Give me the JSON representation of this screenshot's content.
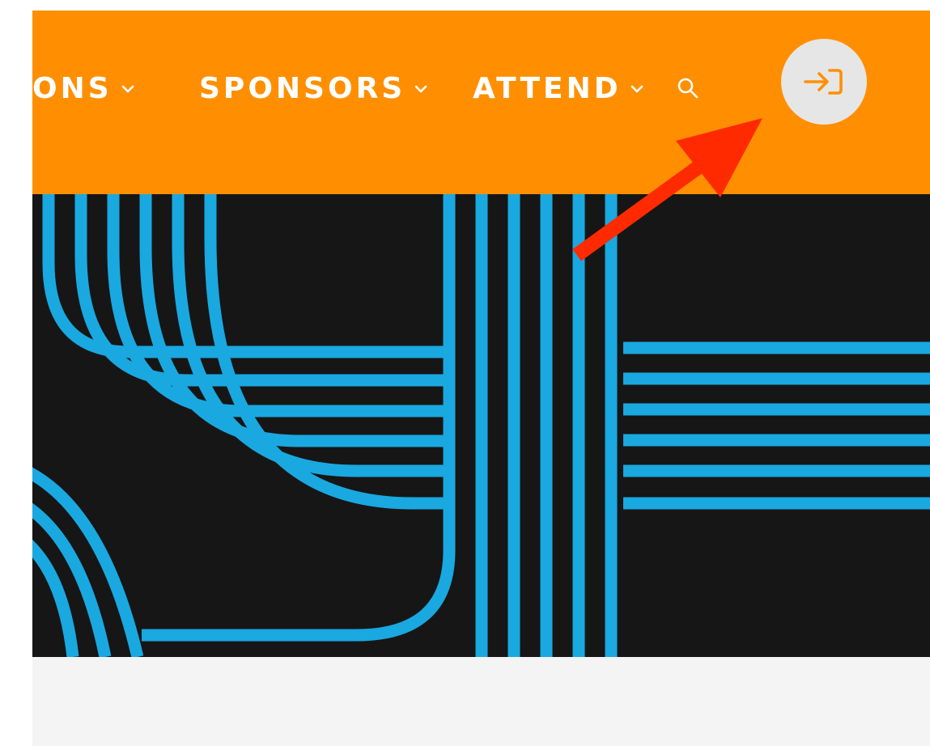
{
  "nav": {
    "items": [
      {
        "label": "ONS"
      },
      {
        "label": "SPONSORS"
      },
      {
        "label": "ATTEND"
      }
    ],
    "search_icon": "search-icon",
    "login_icon": "login-arrow-icon"
  },
  "colors": {
    "topbar": "#ff8f00",
    "hero_background": "#161616",
    "hero_lines": "#1aa8e0",
    "login_button": "#e6e6e6",
    "annotation_arrow": "#ff2a00"
  }
}
